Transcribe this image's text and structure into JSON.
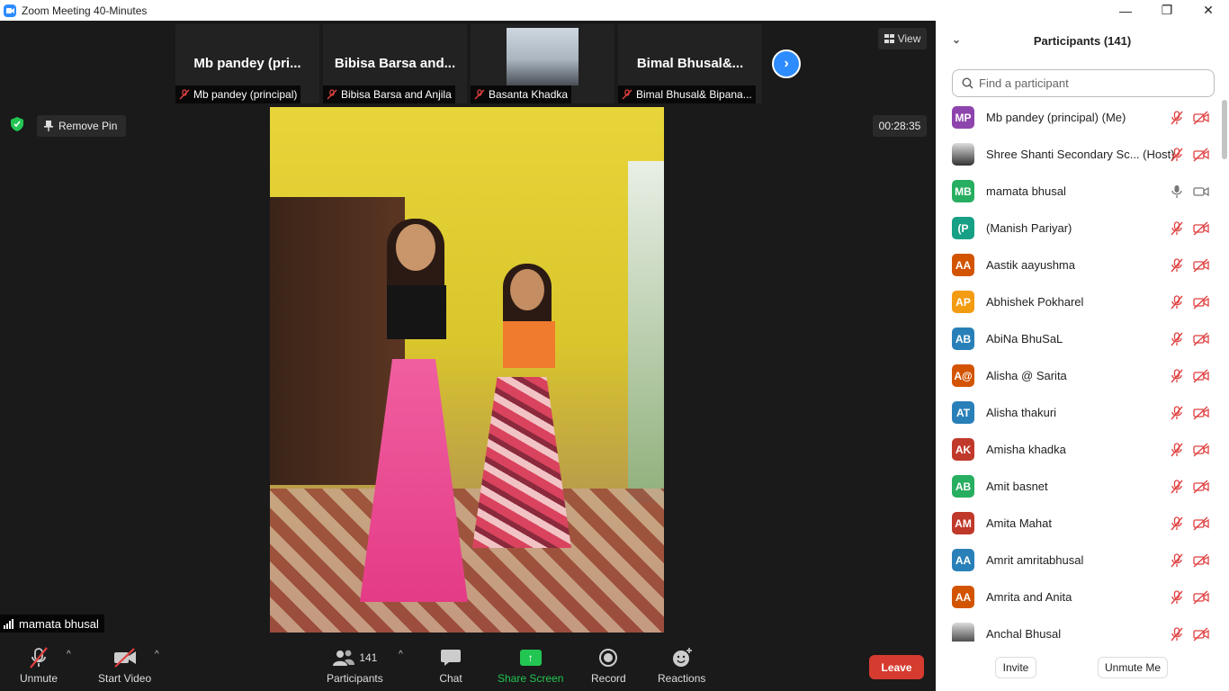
{
  "window": {
    "title": "Zoom Meeting 40-Minutes",
    "controls": {
      "minimize": "—",
      "maximize": "❐",
      "close": "✕"
    }
  },
  "video_strip": {
    "tiles": [
      {
        "big_name": "Mb  pandey  (pri...",
        "label": "Mb pandey (principal)"
      },
      {
        "big_name": "Bibisa Barsa and...",
        "label": "Bibisa Barsa and Anjila"
      },
      {
        "big_name": "",
        "label": "Basanta Khadka"
      },
      {
        "big_name": "Bimal  Bhusal&...",
        "label": "Bimal Bhusal& Bipana..."
      }
    ],
    "next_arrow": "›"
  },
  "view_button": {
    "label": "View"
  },
  "remove_pin": {
    "label": "Remove Pin"
  },
  "timer": {
    "value": "00:28:35"
  },
  "self_view": {
    "name": "mamata bhusal"
  },
  "toolbar": {
    "unmute": "Unmute",
    "start_video": "Start Video",
    "participants": "Participants",
    "participants_count": "141",
    "chat": "Chat",
    "share_screen": "Share Screen",
    "record": "Record",
    "reactions": "Reactions",
    "leave": "Leave",
    "caret": "^"
  },
  "panel": {
    "title": "Participants (141)",
    "chevron": "⌄",
    "search_placeholder": "Find a participant",
    "participants": [
      {
        "initials": "MP",
        "name": "Mb pandey (principal) (Me)",
        "color": "#8e44ad",
        "muted": true
      },
      {
        "initials": "",
        "name": "Shree Shanti Secondary Sc... (Host)",
        "color": "#666666",
        "muted": true
      },
      {
        "initials": "MB",
        "name": "mamata bhusal",
        "color": "#27ae60",
        "muted": false
      },
      {
        "initials": "(P",
        "name": "(Manish Pariyar)",
        "color": "#16a085",
        "muted": true
      },
      {
        "initials": "AA",
        "name": "Aastik aayushma",
        "color": "#d35400",
        "muted": true
      },
      {
        "initials": "AP",
        "name": "Abhishek Pokharel",
        "color": "#f39c12",
        "muted": true
      },
      {
        "initials": "AB",
        "name": "AbiNa BhuSaL",
        "color": "#2980b9",
        "muted": true
      },
      {
        "initials": "A@",
        "name": "Alisha @ Sarita",
        "color": "#d35400",
        "muted": true
      },
      {
        "initials": "AT",
        "name": "Alisha thakuri",
        "color": "#2980b9",
        "muted": true
      },
      {
        "initials": "AK",
        "name": "Amisha khadka",
        "color": "#c0392b",
        "muted": true
      },
      {
        "initials": "AB",
        "name": "Amit basnet",
        "color": "#27ae60",
        "muted": true
      },
      {
        "initials": "AM",
        "name": "Amita Mahat",
        "color": "#c0392b",
        "muted": true
      },
      {
        "initials": "AA",
        "name": "Amrit amritabhusal",
        "color": "#2980b9",
        "muted": true
      },
      {
        "initials": "AA",
        "name": "Amrita  and Anita",
        "color": "#d35400",
        "muted": true
      },
      {
        "initials": "",
        "name": "Anchal Bhusal",
        "color": "#222222",
        "muted": true
      }
    ],
    "invite": "Invite",
    "unmute_me": "Unmute Me"
  }
}
